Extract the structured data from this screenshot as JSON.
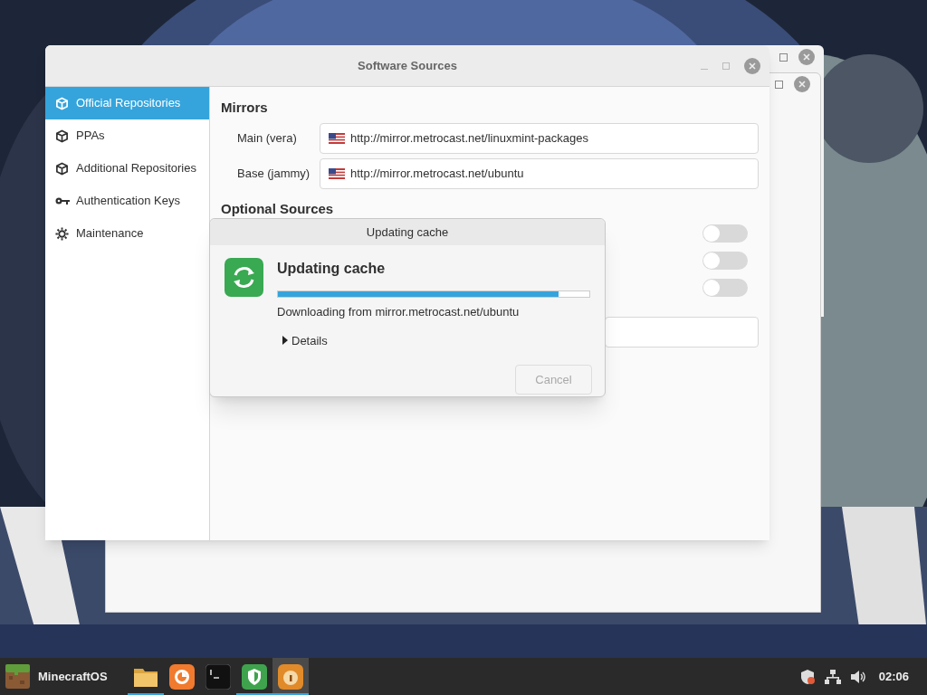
{
  "window": {
    "title": "Software Sources",
    "sidebar": {
      "items": [
        {
          "label": "Official Repositories",
          "selected": true
        },
        {
          "label": "PPAs",
          "selected": false
        },
        {
          "label": "Additional Repositories",
          "selected": false
        },
        {
          "label": "Authentication Keys",
          "selected": false
        },
        {
          "label": "Maintenance",
          "selected": false
        }
      ]
    },
    "mirrors": {
      "heading": "Mirrors",
      "rows": [
        {
          "label": "Main (vera)",
          "value": "http://mirror.metrocast.net/linuxmint-packages"
        },
        {
          "label": "Base (jammy)",
          "value": "http://mirror.metrocast.net/ubuntu"
        }
      ]
    },
    "optional_sources": {
      "heading": "Optional Sources",
      "toggles": [
        {
          "on": false
        },
        {
          "on": false
        },
        {
          "on": false
        }
      ]
    }
  },
  "dialog": {
    "title": "Updating cache",
    "heading": "Updating cache",
    "progress": {
      "level": 0.9
    },
    "status": "Downloading from mirror.metrocast.net/ubuntu",
    "details": {
      "label": "Details",
      "expanded": false
    },
    "cancel": {
      "label": "Cancel",
      "disabled": true
    }
  },
  "taskbar": {
    "menu": {
      "label": "MinecraftOS"
    },
    "apps": [
      {
        "running": true,
        "active": false
      },
      {
        "running": false,
        "active": false
      },
      {
        "running": false,
        "active": false
      },
      {
        "running": true,
        "active": false
      },
      {
        "running": true,
        "active": true
      }
    ],
    "clock": "02:06"
  }
}
